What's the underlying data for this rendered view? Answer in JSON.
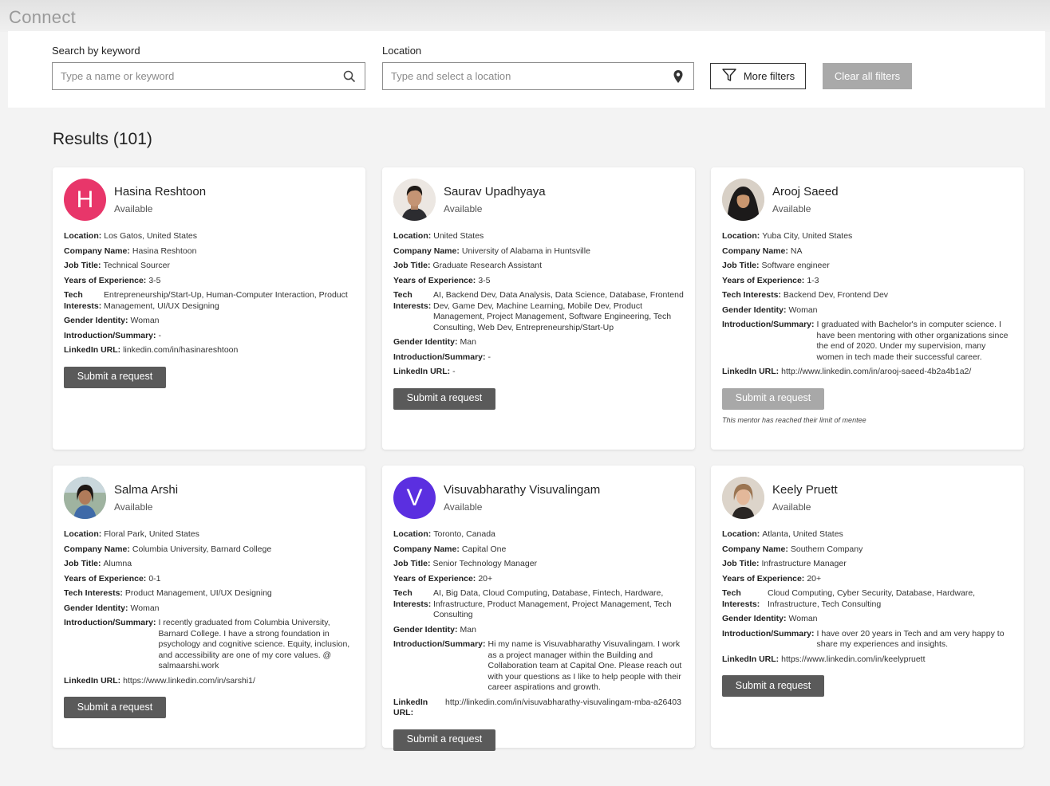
{
  "app": {
    "title": "Connect"
  },
  "filters": {
    "keyword_label": "Search by keyword",
    "keyword_placeholder": "Type a name or keyword",
    "location_label": "Location",
    "location_placeholder": "Type and select a location",
    "more_filters": "More filters",
    "clear_filters": "Clear all filters"
  },
  "results": {
    "title": "Results (101)",
    "cards": [
      {
        "name": "Hasina Reshtoon",
        "status": "Available",
        "initial": "H",
        "avatar_color": "#e8366a",
        "location": "Los Gatos, United States",
        "company": "Hasina Reshtoon",
        "job_title": "Technical Sourcer",
        "experience": "3-5",
        "tech": "Entrepreneurship/Start-Up, Human-Computer Interaction, Product Management, UI/UX Designing",
        "gender": "Woman",
        "intro": "-",
        "linkedin": "linkedin.com/in/hasinareshtoon",
        "button": "Submit a request"
      },
      {
        "name": "Saurav Upadhyaya",
        "status": "Available",
        "location": "United States",
        "company": "University of Alabama in Huntsville",
        "job_title": "Graduate Research Assistant",
        "experience": "3-5",
        "tech": "AI, Backend Dev, Data Analysis, Data Science, Database, Frontend Dev, Game Dev, Machine Learning, Mobile Dev, Product Management, Project Management, Software Engineering, Tech Consulting, Web Dev, Entrepreneurship/Start-Up",
        "gender": "Man",
        "intro": "-",
        "linkedin": "-",
        "button": "Submit a request"
      },
      {
        "name": "Arooj Saeed",
        "status": "Available",
        "location": "Yuba City, United States",
        "company": "NA",
        "job_title": "Software engineer",
        "experience": "1-3",
        "tech": "Backend Dev, Frontend Dev",
        "gender": "Woman",
        "intro": "I graduated with Bachelor's in computer science. I have been mentoring with other organizations since the end of 2020. Under my supervision, many women in tech made their successful career.",
        "linkedin": "http://www.linkedin.com/in/arooj-saeed-4b2a4b1a2/",
        "button": "Submit a request",
        "note": "This mentor has reached their limit of mentee"
      },
      {
        "name": "Salma Arshi",
        "status": "Available",
        "location": "Floral Park, United States",
        "company": "Columbia University, Barnard College",
        "job_title": "Alumna",
        "experience": "0-1",
        "tech": "Product Management, UI/UX Designing",
        "gender": "Woman",
        "intro": "I recently graduated from Columbia University, Barnard College. I have a strong foundation in psychology and cognitive science. Equity, inclusion, and accessibility are one of my core values. @ salmaarshi.work",
        "linkedin": "https://www.linkedin.com/in/sarshi1/",
        "button": "Submit a request"
      },
      {
        "name": "Visuvabharathy Visuvalingam",
        "status": "Available",
        "initial": "V",
        "avatar_color": "#5b2fe0",
        "location": "Toronto, Canada",
        "company": "Capital One",
        "job_title": "Senior Technology Manager",
        "experience": "20+",
        "tech": "AI, Big Data, Cloud Computing, Database, Fintech, Hardware, Infrastructure, Product Management, Project Management, Tech Consulting",
        "gender": "Man",
        "intro": "Hi my name is Visuvabharathy Visuvalingam. I work as a project manager within the Building and Collaboration team at Capital One. Please reach out with your questions as I like to help people with their career aspirations and growth.",
        "linkedin": "http://linkedin.com/in/visuvabharathy-visuvalingam-mba-a26403",
        "button": "Submit a request"
      },
      {
        "name": "Keely Pruett",
        "status": "Available",
        "location": "Atlanta, United States",
        "company": "Southern Company",
        "job_title": "Infrastructure Manager",
        "experience": "20+",
        "tech": "Cloud Computing, Cyber Security, Database, Hardware, Infrastructure, Tech Consulting",
        "gender": "Woman",
        "intro": "I have over 20 years in Tech and am very happy to share my experiences and insights.",
        "linkedin": "https://www.linkedin.com/in/keelypruett",
        "button": "Submit a request"
      }
    ]
  },
  "field_labels": {
    "location": "Location:",
    "company": "Company Name:",
    "job_title": "Job Title:",
    "experience": "Years of Experience:",
    "tech": "Tech Interests:",
    "gender": "Gender Identity:",
    "intro": "Introduction/Summary:",
    "linkedin": "LinkedIn URL:"
  }
}
